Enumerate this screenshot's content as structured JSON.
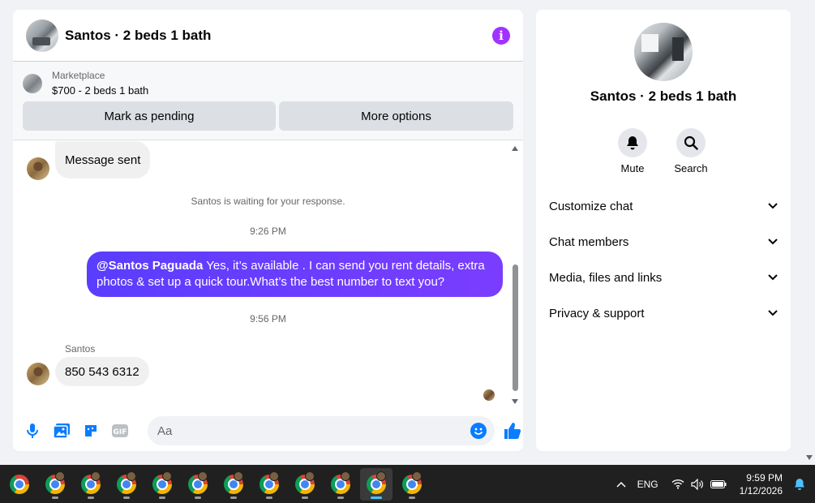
{
  "chat": {
    "title": "Santos · 2 beds 1 bath",
    "marketplace": {
      "label": "Marketplace",
      "listing": "$700 - 2 beds 1 bath",
      "pending_label": "Mark as pending",
      "more_label": "More options"
    },
    "messages": {
      "first_incoming": "Message sent",
      "waiting_notice": "Santos is waiting for your response.",
      "time1": "9:26 PM",
      "outgoing_mention": "@Santos Paguada",
      "outgoing_text": " Yes, it’s available .  I can send you rent details, extra photos & set up a quick tour.What’s the best number to text you?",
      "time2": "9:56 PM",
      "sender_name": "Santos",
      "last_incoming": "850 543 6312"
    },
    "composer": {
      "placeholder": "Aa"
    },
    "colors": {
      "accent": "#a033ff",
      "outgoing_start": "#5a3dff",
      "outgoing_end": "#7a3dff",
      "like": "#0a7cff"
    }
  },
  "side": {
    "name": "Santos · 2 beds 1 bath",
    "actions": {
      "mute": "Mute",
      "search": "Search"
    },
    "sections": [
      "Customize chat",
      "Chat members",
      "Media, files and links",
      "Privacy & support"
    ]
  },
  "taskbar": {
    "language": "ENG",
    "time": "9:59 PM",
    "date": "1/12/2026"
  }
}
